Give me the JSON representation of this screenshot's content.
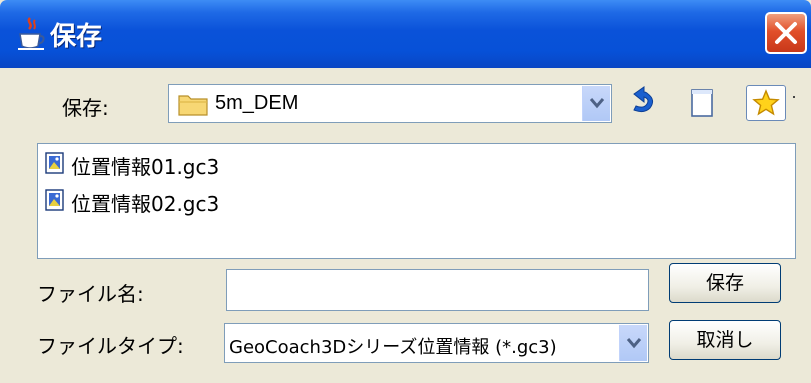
{
  "window": {
    "title": "保存",
    "icons": {
      "app": "java-coffee-cup-icon",
      "close": "close-x-icon"
    },
    "colors": {
      "titlebar": "#0a52d9",
      "close": "#e2502a",
      "body": "#ece9d8",
      "field_border": "#7f9db9"
    }
  },
  "save_in": {
    "label": "保存:",
    "folder": "5m_DEM",
    "folder_icon": "folder-icon"
  },
  "toolbar": {
    "icons": [
      "up-folder-icon",
      "new-folder-icon",
      "favorites-star-icon"
    ]
  },
  "files": [
    {
      "name": "位置情報01.gc3",
      "icon": "image-file-icon"
    },
    {
      "name": "位置情報02.gc3",
      "icon": "image-file-icon"
    }
  ],
  "filename": {
    "label": "ファイル名:",
    "value": ""
  },
  "filetype": {
    "label": "ファイルタイプ:",
    "value": "GeoCoach3Dシリーズ位置情報 (*.gc3)"
  },
  "buttons": {
    "save": "保存",
    "cancel": "取消し"
  }
}
